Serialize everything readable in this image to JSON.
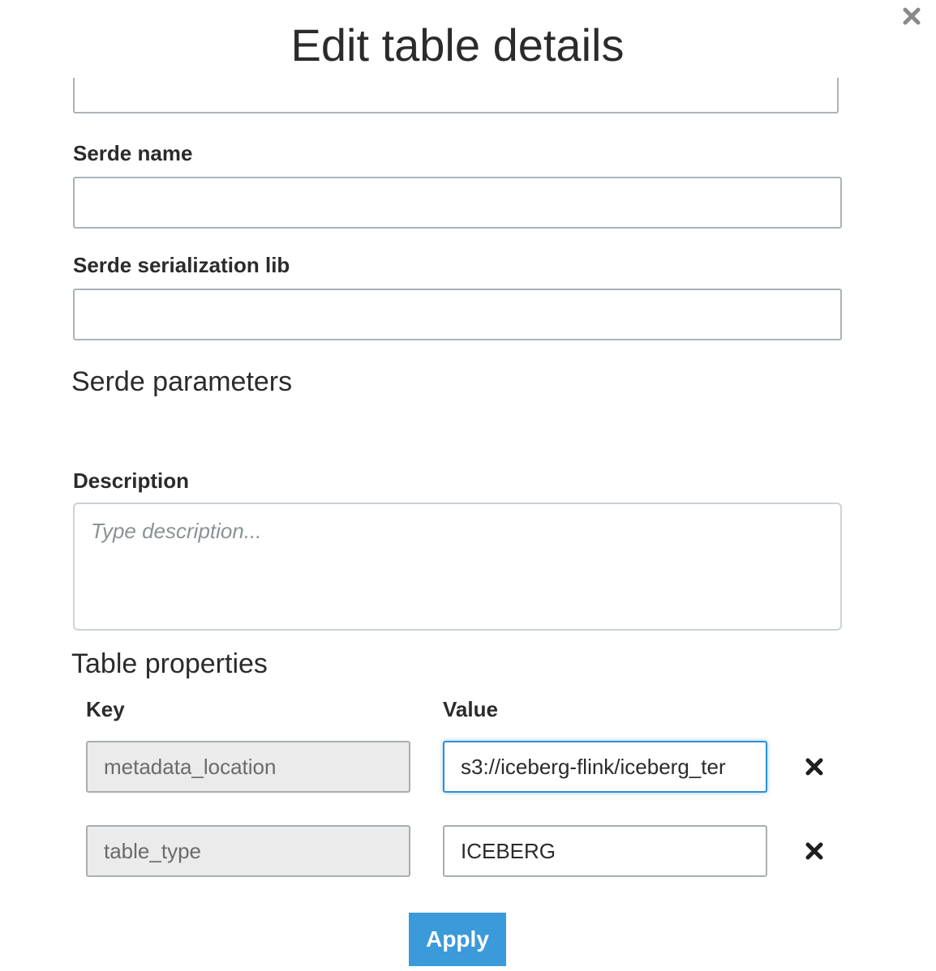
{
  "dialog": {
    "title": "Edit table details",
    "close_icon": "close-icon"
  },
  "fields": {
    "serde_name": {
      "label": "Serde name",
      "value": ""
    },
    "serde_serialization_lib": {
      "label": "Serde serialization lib",
      "value": ""
    }
  },
  "serde_parameters": {
    "heading": "Serde parameters"
  },
  "description": {
    "label": "Description",
    "placeholder": "Type description...",
    "value": ""
  },
  "table_properties": {
    "heading": "Table properties",
    "key_header": "Key",
    "value_header": "Value",
    "rows": [
      {
        "key": "metadata_location",
        "value": "s3://iceberg-flink/iceberg_ter"
      },
      {
        "key": "table_type",
        "value": "ICEBERG"
      }
    ],
    "remove_icon": "remove-icon"
  },
  "actions": {
    "apply_label": "Apply"
  },
  "colors": {
    "accent": "#3b9ad9",
    "focus_border": "#2d8fd5",
    "readonly_bg": "#ebebeb"
  }
}
